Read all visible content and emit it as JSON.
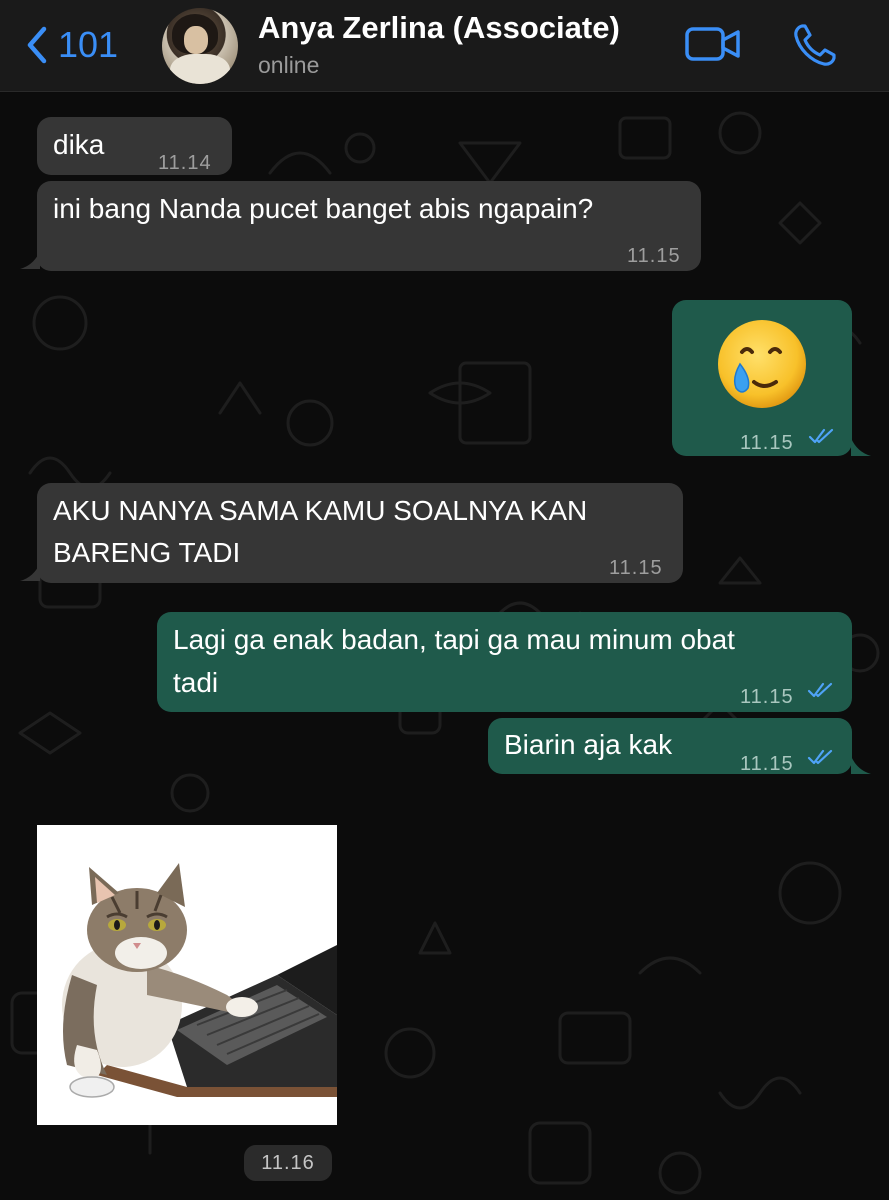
{
  "header": {
    "back_count": "101",
    "contact_name": "Anya Zerlina (Associate)",
    "contact_status": "online",
    "accent_color": "#3a8ef6"
  },
  "messages": [
    {
      "direction": "incoming",
      "text": "dika",
      "time": "11.14"
    },
    {
      "direction": "incoming",
      "text": "ini bang Nanda pucet banget abis ngapain?",
      "time": "11.15"
    },
    {
      "direction": "outgoing",
      "emoji": "🥲",
      "time": "11.15",
      "status": "read"
    },
    {
      "direction": "incoming",
      "text_lines": [
        "AKU NANYA SAMA KAMU SOALNYA KAN",
        "BARENG TADI"
      ],
      "time": "11.15"
    },
    {
      "direction": "outgoing",
      "text_lines": [
        "Lagi ga enak badan, tapi ga mau minum obat",
        "tadi"
      ],
      "time": "11.15",
      "status": "read"
    },
    {
      "direction": "outgoing",
      "text": "Biarin aja kak",
      "time": "11.15",
      "status": "read"
    },
    {
      "direction": "incoming",
      "sticker": "cat-typing-on-keyboard",
      "time": "11.16"
    }
  ],
  "colors": {
    "incoming_bubble": "#363636",
    "outgoing_bubble": "#1f5a4b",
    "read_ticks": "#4fa3f7"
  }
}
